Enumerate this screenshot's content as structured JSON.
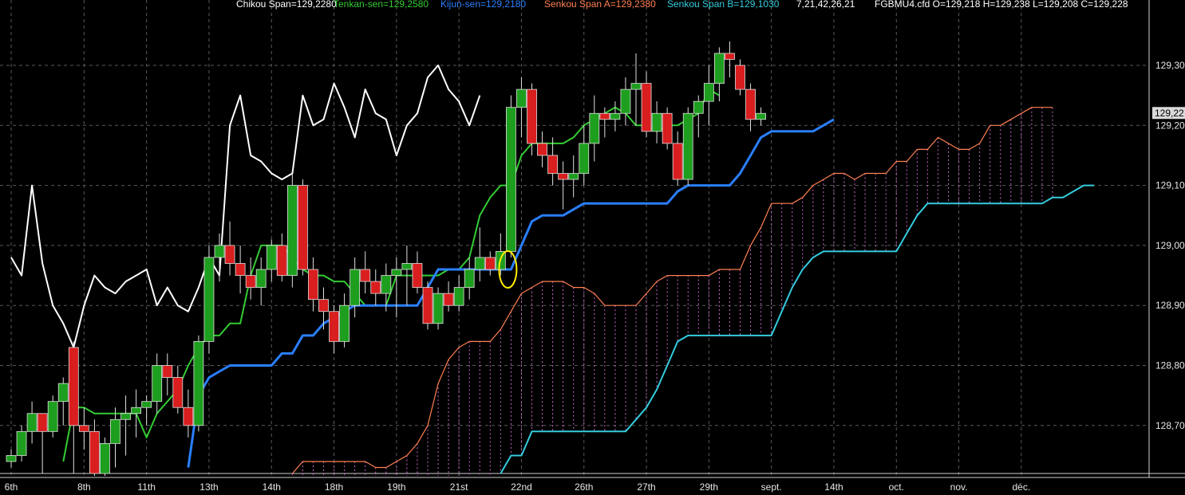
{
  "header": {
    "chikou": "Chikou Span=129,2280",
    "tenkan": "Tenkan-sen=129,2580",
    "kijun": "Kijun-sen=129,2180",
    "senkou_a": "Senkou Span A=129,2380",
    "senkou_b": "Senkou Span B=129,1030",
    "params": "7,21,42,26,21",
    "ohlc": "FGBMU4.cfd O=129,218 H=129,238 L=129,208 C=129,228"
  },
  "colors": {
    "bg": "#000000",
    "up": "#1e9e1e",
    "down": "#d81e1e",
    "chikou": "#ffffff",
    "tenkan": "#33cc33",
    "kijun": "#2a7fff",
    "senkou_a": "#ff7f50",
    "senkou_b": "#33ccdd",
    "cloud": "#cc66cc",
    "marker": "#ffee00"
  },
  "chart_data": {
    "type": "candlestick",
    "instrument": "FGBMU4.cfd",
    "ylim": [
      128.63,
      129.36
    ],
    "y_ticks": [
      {
        "v": 129.3,
        "label": "129,30"
      },
      {
        "v": 129.2,
        "label": "129,20"
      },
      {
        "v": 129.1,
        "label": "129,10"
      },
      {
        "v": 129.0,
        "label": "129,00"
      },
      {
        "v": 128.9,
        "label": "128,90"
      },
      {
        "v": 128.8,
        "label": "128,80"
      },
      {
        "v": 128.7,
        "label": "128,70"
      }
    ],
    "last_price_label": "129,22",
    "last_price": 129.22,
    "x_ticks": [
      "6th",
      "8th",
      "11th",
      "13th",
      "14th",
      "18th",
      "19th",
      "21st",
      "22nd",
      "26th",
      "27th",
      "29th",
      "sept.",
      "14th",
      "oct.",
      "nov.",
      "déc."
    ],
    "x_tick_index": [
      0,
      7,
      13,
      19,
      25,
      31,
      37,
      43,
      49,
      55,
      61,
      67,
      73,
      79,
      85,
      91,
      97
    ],
    "candles": [
      [
        128.64,
        128.66,
        128.63,
        128.65
      ],
      [
        128.65,
        128.7,
        128.64,
        128.69
      ],
      [
        128.69,
        128.74,
        128.67,
        128.72
      ],
      [
        128.72,
        128.71,
        128.62,
        128.69
      ],
      [
        128.69,
        128.75,
        128.68,
        128.74
      ],
      [
        128.74,
        128.78,
        128.7,
        128.77
      ],
      [
        128.83,
        128.84,
        128.62,
        128.7
      ],
      [
        128.7,
        128.73,
        128.66,
        128.69
      ],
      [
        128.69,
        128.71,
        128.6,
        128.62
      ],
      [
        128.62,
        128.68,
        128.6,
        128.67
      ],
      [
        128.67,
        128.73,
        128.63,
        128.71
      ],
      [
        128.71,
        128.75,
        128.65,
        128.72
      ],
      [
        128.72,
        128.76,
        128.68,
        128.73
      ],
      [
        128.73,
        128.75,
        128.7,
        128.74
      ],
      [
        128.74,
        128.82,
        128.72,
        128.8
      ],
      [
        128.8,
        128.82,
        128.75,
        128.78
      ],
      [
        128.78,
        128.8,
        128.72,
        128.73
      ],
      [
        128.73,
        128.76,
        128.68,
        128.7
      ],
      [
        128.7,
        128.85,
        128.69,
        128.84
      ],
      [
        128.84,
        129.0,
        128.82,
        128.98
      ],
      [
        128.98,
        129.02,
        128.94,
        129.0
      ],
      [
        129.0,
        129.04,
        128.95,
        128.97
      ],
      [
        128.97,
        129.0,
        128.92,
        128.95
      ],
      [
        128.95,
        128.98,
        128.91,
        128.93
      ],
      [
        128.93,
        128.98,
        128.9,
        128.96
      ],
      [
        128.96,
        129.01,
        128.94,
        129.0
      ],
      [
        129.0,
        129.02,
        128.94,
        128.95
      ],
      [
        128.95,
        129.12,
        128.93,
        129.1
      ],
      [
        129.1,
        129.11,
        128.95,
        128.96
      ],
      [
        128.96,
        128.98,
        128.89,
        128.91
      ],
      [
        128.91,
        128.93,
        128.86,
        128.89
      ],
      [
        128.89,
        128.9,
        128.82,
        128.84
      ],
      [
        128.84,
        128.92,
        128.83,
        128.9
      ],
      [
        128.9,
        128.98,
        128.88,
        128.96
      ],
      [
        128.96,
        128.99,
        128.92,
        128.94
      ],
      [
        128.94,
        128.96,
        128.9,
        128.92
      ],
      [
        128.92,
        128.97,
        128.89,
        128.95
      ],
      [
        128.95,
        128.98,
        128.88,
        128.96
      ],
      [
        128.96,
        129.0,
        128.9,
        128.97
      ],
      [
        128.97,
        128.99,
        128.92,
        128.93
      ],
      [
        128.93,
        128.94,
        128.86,
        128.87
      ],
      [
        128.87,
        128.93,
        128.86,
        128.92
      ],
      [
        128.92,
        128.94,
        128.89,
        128.9
      ],
      [
        128.9,
        128.95,
        128.89,
        128.93
      ],
      [
        128.93,
        128.98,
        128.91,
        128.96
      ],
      [
        128.96,
        129.03,
        128.94,
        128.98
      ],
      [
        128.98,
        128.99,
        128.95,
        128.96
      ],
      [
        128.96,
        129.02,
        128.95,
        128.99
      ],
      [
        128.99,
        129.25,
        128.98,
        129.23
      ],
      [
        129.23,
        129.28,
        129.18,
        129.26
      ],
      [
        129.26,
        129.27,
        129.15,
        129.17
      ],
      [
        129.17,
        129.19,
        129.13,
        129.15
      ],
      [
        129.15,
        129.18,
        129.1,
        129.12
      ],
      [
        129.12,
        129.14,
        129.06,
        129.11
      ],
      [
        129.11,
        129.15,
        129.08,
        129.12
      ],
      [
        129.12,
        129.2,
        129.1,
        129.17
      ],
      [
        129.17,
        129.25,
        129.14,
        129.22
      ],
      [
        129.22,
        129.23,
        129.18,
        129.21
      ],
      [
        129.21,
        129.24,
        129.19,
        129.22
      ],
      [
        129.22,
        129.28,
        129.2,
        129.26
      ],
      [
        129.26,
        129.32,
        129.2,
        129.27
      ],
      [
        129.27,
        129.29,
        129.18,
        129.19
      ],
      [
        129.19,
        129.24,
        129.17,
        129.22
      ],
      [
        129.22,
        129.23,
        129.16,
        129.17
      ],
      [
        129.17,
        129.19,
        129.1,
        129.11
      ],
      [
        129.11,
        129.23,
        129.1,
        129.22
      ],
      [
        129.22,
        129.25,
        129.18,
        129.24
      ],
      [
        129.24,
        129.3,
        129.2,
        129.27
      ],
      [
        129.27,
        129.33,
        129.24,
        129.32
      ],
      [
        129.32,
        129.34,
        129.28,
        129.31
      ],
      [
        129.3,
        129.31,
        129.25,
        129.26
      ],
      [
        129.26,
        129.27,
        129.19,
        129.21
      ],
      [
        129.21,
        129.23,
        129.2,
        129.22
      ]
    ],
    "series": [
      {
        "name": "Chikou Span",
        "start": 0,
        "values": [
          128.98,
          128.95,
          129.1,
          128.97,
          128.9,
          128.87,
          128.83,
          128.9,
          128.95,
          128.93,
          128.92,
          128.94,
          128.95,
          128.96,
          128.9,
          128.93,
          128.9,
          128.89,
          128.93,
          128.98,
          128.95,
          129.2,
          129.25,
          129.15,
          129.14,
          129.12,
          129.11,
          129.12,
          129.25,
          129.2,
          129.21,
          129.27,
          129.23,
          129.18,
          129.26,
          129.22,
          129.21,
          129.15,
          129.2,
          129.22,
          129.28,
          129.3,
          129.26,
          129.24,
          129.2,
          129.25
        ]
      },
      {
        "name": "Tenkan-sen",
        "start": 5,
        "values": [
          128.64,
          128.73,
          128.73,
          128.72,
          128.72,
          128.72,
          128.72,
          128.72,
          128.68,
          128.72,
          128.74,
          128.76,
          128.8,
          128.83,
          128.85,
          128.85,
          128.87,
          128.87,
          128.95,
          129.0,
          129.0,
          129.0,
          128.98,
          128.96,
          128.95,
          128.95,
          128.94,
          128.94,
          128.92,
          128.9,
          128.9,
          128.9,
          128.95,
          128.95,
          128.95,
          128.95,
          128.95,
          128.96,
          128.96,
          128.98,
          129.05,
          129.08,
          129.1,
          129.1,
          129.15,
          129.17,
          129.17,
          129.17,
          129.17,
          129.18,
          129.2,
          129.21,
          129.22,
          129.23,
          129.22,
          129.2,
          129.2,
          129.19,
          129.2,
          129.2,
          129.21,
          129.22,
          129.26,
          129.25
        ]
      },
      {
        "name": "Kijun-sen",
        "start": 17,
        "values": [
          128.63,
          128.75,
          128.78,
          128.79,
          128.8,
          128.8,
          128.8,
          128.8,
          128.8,
          128.82,
          128.82,
          128.85,
          128.85,
          128.87,
          128.88,
          128.89,
          128.9,
          128.9,
          128.9,
          128.9,
          128.9,
          128.9,
          128.9,
          128.93,
          128.96,
          128.96,
          128.96,
          128.96,
          128.96,
          128.96,
          128.96,
          128.96,
          129.0,
          129.04,
          129.05,
          129.05,
          129.05,
          129.06,
          129.07,
          129.07,
          129.07,
          129.07,
          129.07,
          129.07,
          129.07,
          129.07,
          129.07,
          129.09,
          129.1,
          129.1,
          129.1,
          129.1,
          129.1,
          129.12,
          129.15,
          129.18,
          129.19,
          129.19,
          129.19,
          129.19,
          129.19,
          129.2,
          129.21
        ]
      },
      {
        "name": "Senkou Span A",
        "start": 27,
        "values": [
          128.62,
          128.64,
          128.64,
          128.64,
          128.64,
          128.64,
          128.64,
          128.64,
          128.63,
          128.63,
          128.64,
          128.65,
          128.67,
          128.7,
          128.77,
          128.81,
          128.83,
          128.84,
          128.84,
          128.84,
          128.86,
          128.89,
          128.92,
          128.93,
          128.94,
          128.94,
          128.94,
          128.93,
          128.93,
          128.92,
          128.9,
          128.9,
          128.9,
          128.9,
          128.92,
          128.94,
          128.95,
          128.95,
          128.95,
          128.95,
          128.95,
          128.96,
          128.96,
          128.96,
          129.0,
          129.03,
          129.07,
          129.07,
          129.07,
          129.08,
          129.1,
          129.11,
          129.12,
          129.12,
          129.11,
          129.12,
          129.12,
          129.12,
          129.14,
          129.14,
          129.16,
          129.16,
          129.18,
          129.17,
          129.16,
          129.16,
          129.17,
          129.2,
          129.2,
          129.21,
          129.22,
          129.23,
          129.23,
          129.23
        ]
      },
      {
        "name": "Senkou Span B",
        "start": 47,
        "values": [
          128.62,
          128.65,
          128.65,
          128.69,
          128.69,
          128.69,
          128.69,
          128.69,
          128.69,
          128.69,
          128.69,
          128.69,
          128.69,
          128.71,
          128.73,
          128.76,
          128.8,
          128.84,
          128.85,
          128.85,
          128.85,
          128.85,
          128.85,
          128.85,
          128.85,
          128.85,
          128.85,
          128.89,
          128.93,
          128.96,
          128.98,
          128.99,
          128.99,
          128.99,
          128.99,
          128.99,
          128.99,
          128.99,
          128.99,
          129.02,
          129.05,
          129.07,
          129.07,
          129.07,
          129.07,
          129.07,
          129.07,
          129.07,
          129.07,
          129.07,
          129.07,
          129.07,
          129.07,
          129.08,
          129.08,
          129.09,
          129.1,
          129.1
        ]
      }
    ],
    "marker_index": 48,
    "marker_value": 128.96
  }
}
